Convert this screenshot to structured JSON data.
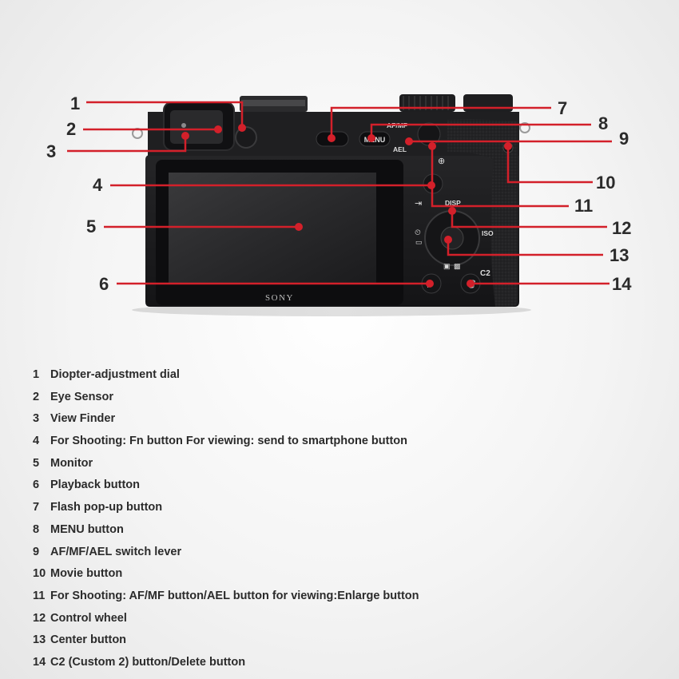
{
  "brand": "SONY",
  "camera_labels": {
    "af_mf": "AF/MF",
    "ael": "AEL",
    "menu": "MENU",
    "disp": "DISP",
    "iso": "ISO",
    "c2": "C2"
  },
  "callouts": [
    {
      "number": "1",
      "target": "diopter-adjustment-dial"
    },
    {
      "number": "2",
      "target": "eye-sensor"
    },
    {
      "number": "3",
      "target": "view-finder"
    },
    {
      "number": "4",
      "target": "fn-button"
    },
    {
      "number": "5",
      "target": "monitor"
    },
    {
      "number": "6",
      "target": "playback-button"
    },
    {
      "number": "7",
      "target": "flash-popup-button"
    },
    {
      "number": "8",
      "target": "menu-button"
    },
    {
      "number": "9",
      "target": "af-mf-ael-lever"
    },
    {
      "number": "10",
      "target": "movie-button"
    },
    {
      "number": "11",
      "target": "af-mf-ael-button"
    },
    {
      "number": "12",
      "target": "control-wheel"
    },
    {
      "number": "13",
      "target": "center-button"
    },
    {
      "number": "14",
      "target": "c2-delete-button"
    }
  ],
  "legend": [
    {
      "number": "1",
      "label": "Diopter-adjustment dial"
    },
    {
      "number": "2",
      "label": "Eye Sensor"
    },
    {
      "number": "3",
      "label": "View Finder"
    },
    {
      "number": "4",
      "label": "For Shooting: Fn button For viewing: send to smartphone button"
    },
    {
      "number": "5",
      "label": "Monitor"
    },
    {
      "number": "6",
      "label": "Playback button"
    },
    {
      "number": "7",
      "label": "Flash pop-up button"
    },
    {
      "number": "8",
      "label": "MENU button"
    },
    {
      "number": "9",
      "label": "AF/MF/AEL switch lever"
    },
    {
      "number": "10",
      "label": "Movie button"
    },
    {
      "number": "11",
      "label": "For Shooting: AF/MF button/AEL button for viewing:Enlarge button"
    },
    {
      "number": "12",
      "label": "Control wheel"
    },
    {
      "number": "13",
      "label": "Center button"
    },
    {
      "number": "14",
      "label": "C2 (Custom 2) button/Delete button"
    }
  ],
  "colors": {
    "callout_line": "#d3202a",
    "body": "#1c1c1e",
    "text": "#2b2b2b"
  }
}
